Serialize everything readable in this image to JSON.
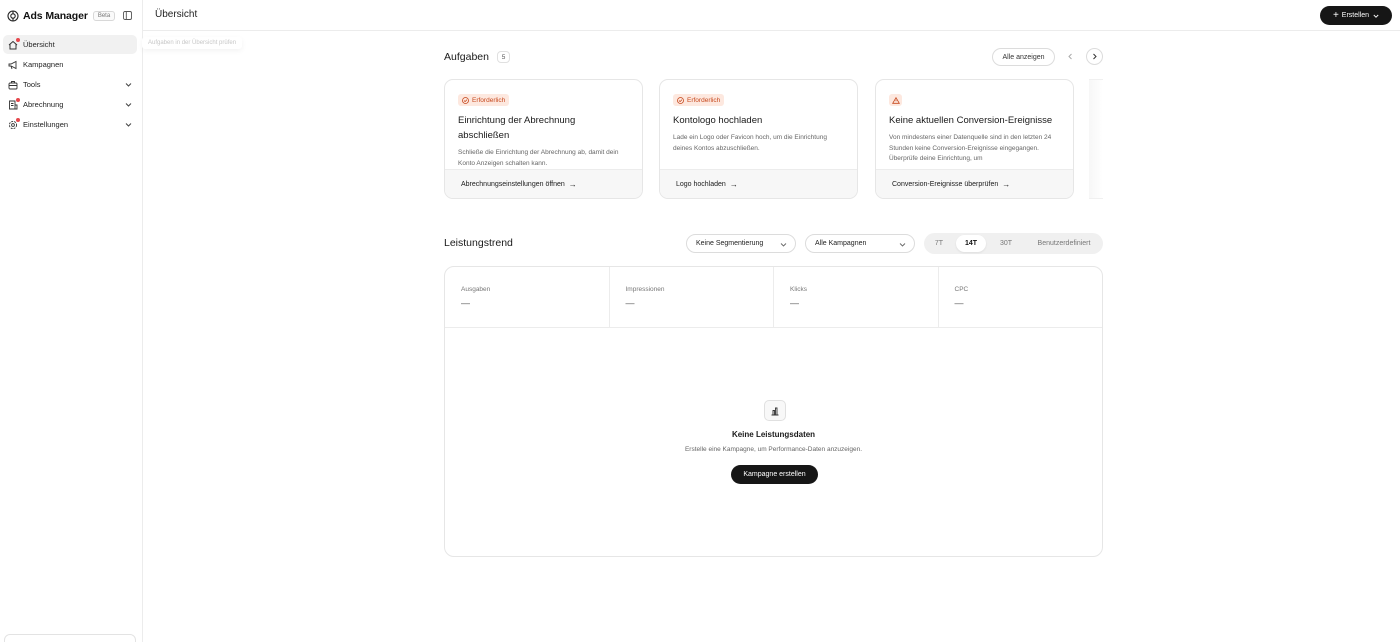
{
  "sidebar": {
    "app_title": "Ads Manager",
    "badge": "Beta",
    "items": [
      {
        "label": "Übersicht",
        "icon": "home-icon",
        "active": true,
        "dot": true,
        "expandable": false
      },
      {
        "label": "Kampagnen",
        "icon": "megaphone-icon",
        "active": false,
        "dot": false,
        "expandable": false
      },
      {
        "label": "Tools",
        "icon": "briefcase-icon",
        "active": false,
        "dot": false,
        "expandable": true
      },
      {
        "label": "Abrechnung",
        "icon": "receipt-icon",
        "active": false,
        "dot": true,
        "expandable": true
      },
      {
        "label": "Einstellungen",
        "icon": "gear-icon",
        "active": false,
        "dot": true,
        "expandable": true
      }
    ]
  },
  "hint": "Aufgaben in der Übersicht prüfen",
  "header": {
    "title": "Übersicht",
    "create_label": "Erstellen"
  },
  "tasks": {
    "title": "Aufgaben",
    "count": "5",
    "show_all": "Alle anzeigen",
    "cards": [
      {
        "badge": "Erforderlich",
        "title": "Einrichtung der Abrechnung abschließen",
        "desc": "Schließe die Einrichtung der Abrechnung ab, damit dein Konto Anzeigen schalten kann.",
        "action": "Abrechnungseinstellungen öffnen"
      },
      {
        "badge": "Erforderlich",
        "title": "Kontologo hochladen",
        "desc": "Lade ein Logo oder Favicon hoch, um die Einrichtung deines Kontos abzuschließen.",
        "action": "Logo hochladen"
      },
      {
        "badge": "",
        "title": "Keine aktuellen Conversion-Ereignisse",
        "desc": "Von mindestens einer Datenquelle sind in den letzten 24 Stunden keine Conversion-Ereignisse eingegangen. Überprüfe deine Einrichtung, um",
        "action": "Conversion-Ereignisse überprüfen"
      }
    ]
  },
  "performance": {
    "title": "Leistungstrend",
    "segment_select": "Keine Segmentierung",
    "campaign_select": "Alle Kampagnen",
    "ranges": [
      "7T",
      "14T",
      "30T",
      "Benutzerdefiniert"
    ],
    "active_range": "14T",
    "metrics": [
      {
        "label": "Ausgaben",
        "value": "—"
      },
      {
        "label": "Impressionen",
        "value": "—"
      },
      {
        "label": "Klicks",
        "value": "—"
      },
      {
        "label": "CPC",
        "value": "—"
      }
    ],
    "empty_title": "Keine Leistungsdaten",
    "empty_desc": "Erstelle eine Kampagne, um Performance-Daten anzuzeigen.",
    "empty_button": "Kampagne erstellen"
  },
  "colors": {
    "accent_dark": "#161616",
    "warning_bg": "#fde8df",
    "warning_text": "#c6471c",
    "notification_dot": "#e5484d"
  }
}
